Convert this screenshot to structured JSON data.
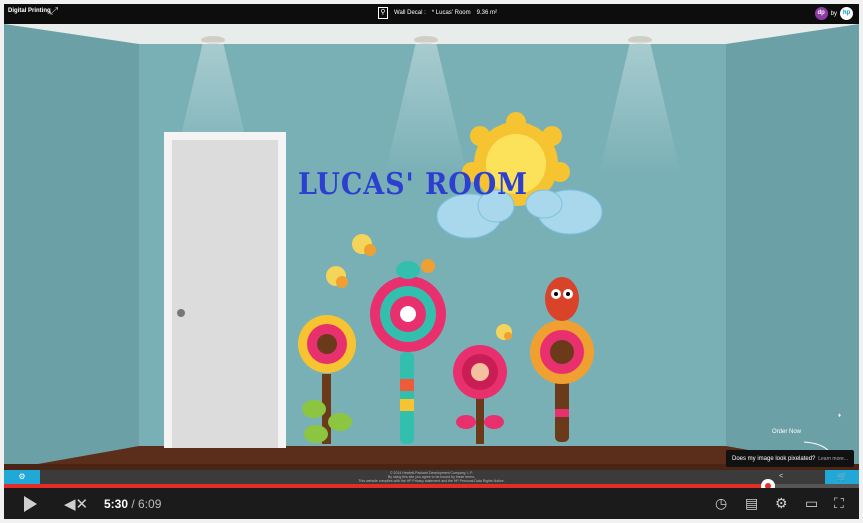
{
  "topbar": {
    "brand": "Digital Printing",
    "wall_label": "Wall Decal :",
    "design": "* Lucas' Room",
    "area": "9.36 m²",
    "by": "by",
    "dp_logo": "dp",
    "hp_logo": "hp"
  },
  "room": {
    "wall_text": "LUCAS' ROOM",
    "order_now": "Order Now",
    "pixel_question": "Does my image look pixelated?",
    "learn_more": "Learn more..."
  },
  "strip": {
    "copyright_1": "© 2014 Hewlett-Packard Development Company, L.P.",
    "copyright_2": "By using this site you agree to be bound by these terms.",
    "copyright_3": "This website complies with the HP Privacy statement and the HP Personal Data Rights Notice."
  },
  "player": {
    "current_time": "5:30",
    "separator": " / ",
    "duration": "6:09",
    "progress_fraction": 0.894
  },
  "colors": {
    "wall": "#7fb7bc",
    "floor": "#5a2e1a",
    "accent": "#21a8d6",
    "progress": "#e52d27",
    "title_text": "#2c3fd0"
  }
}
